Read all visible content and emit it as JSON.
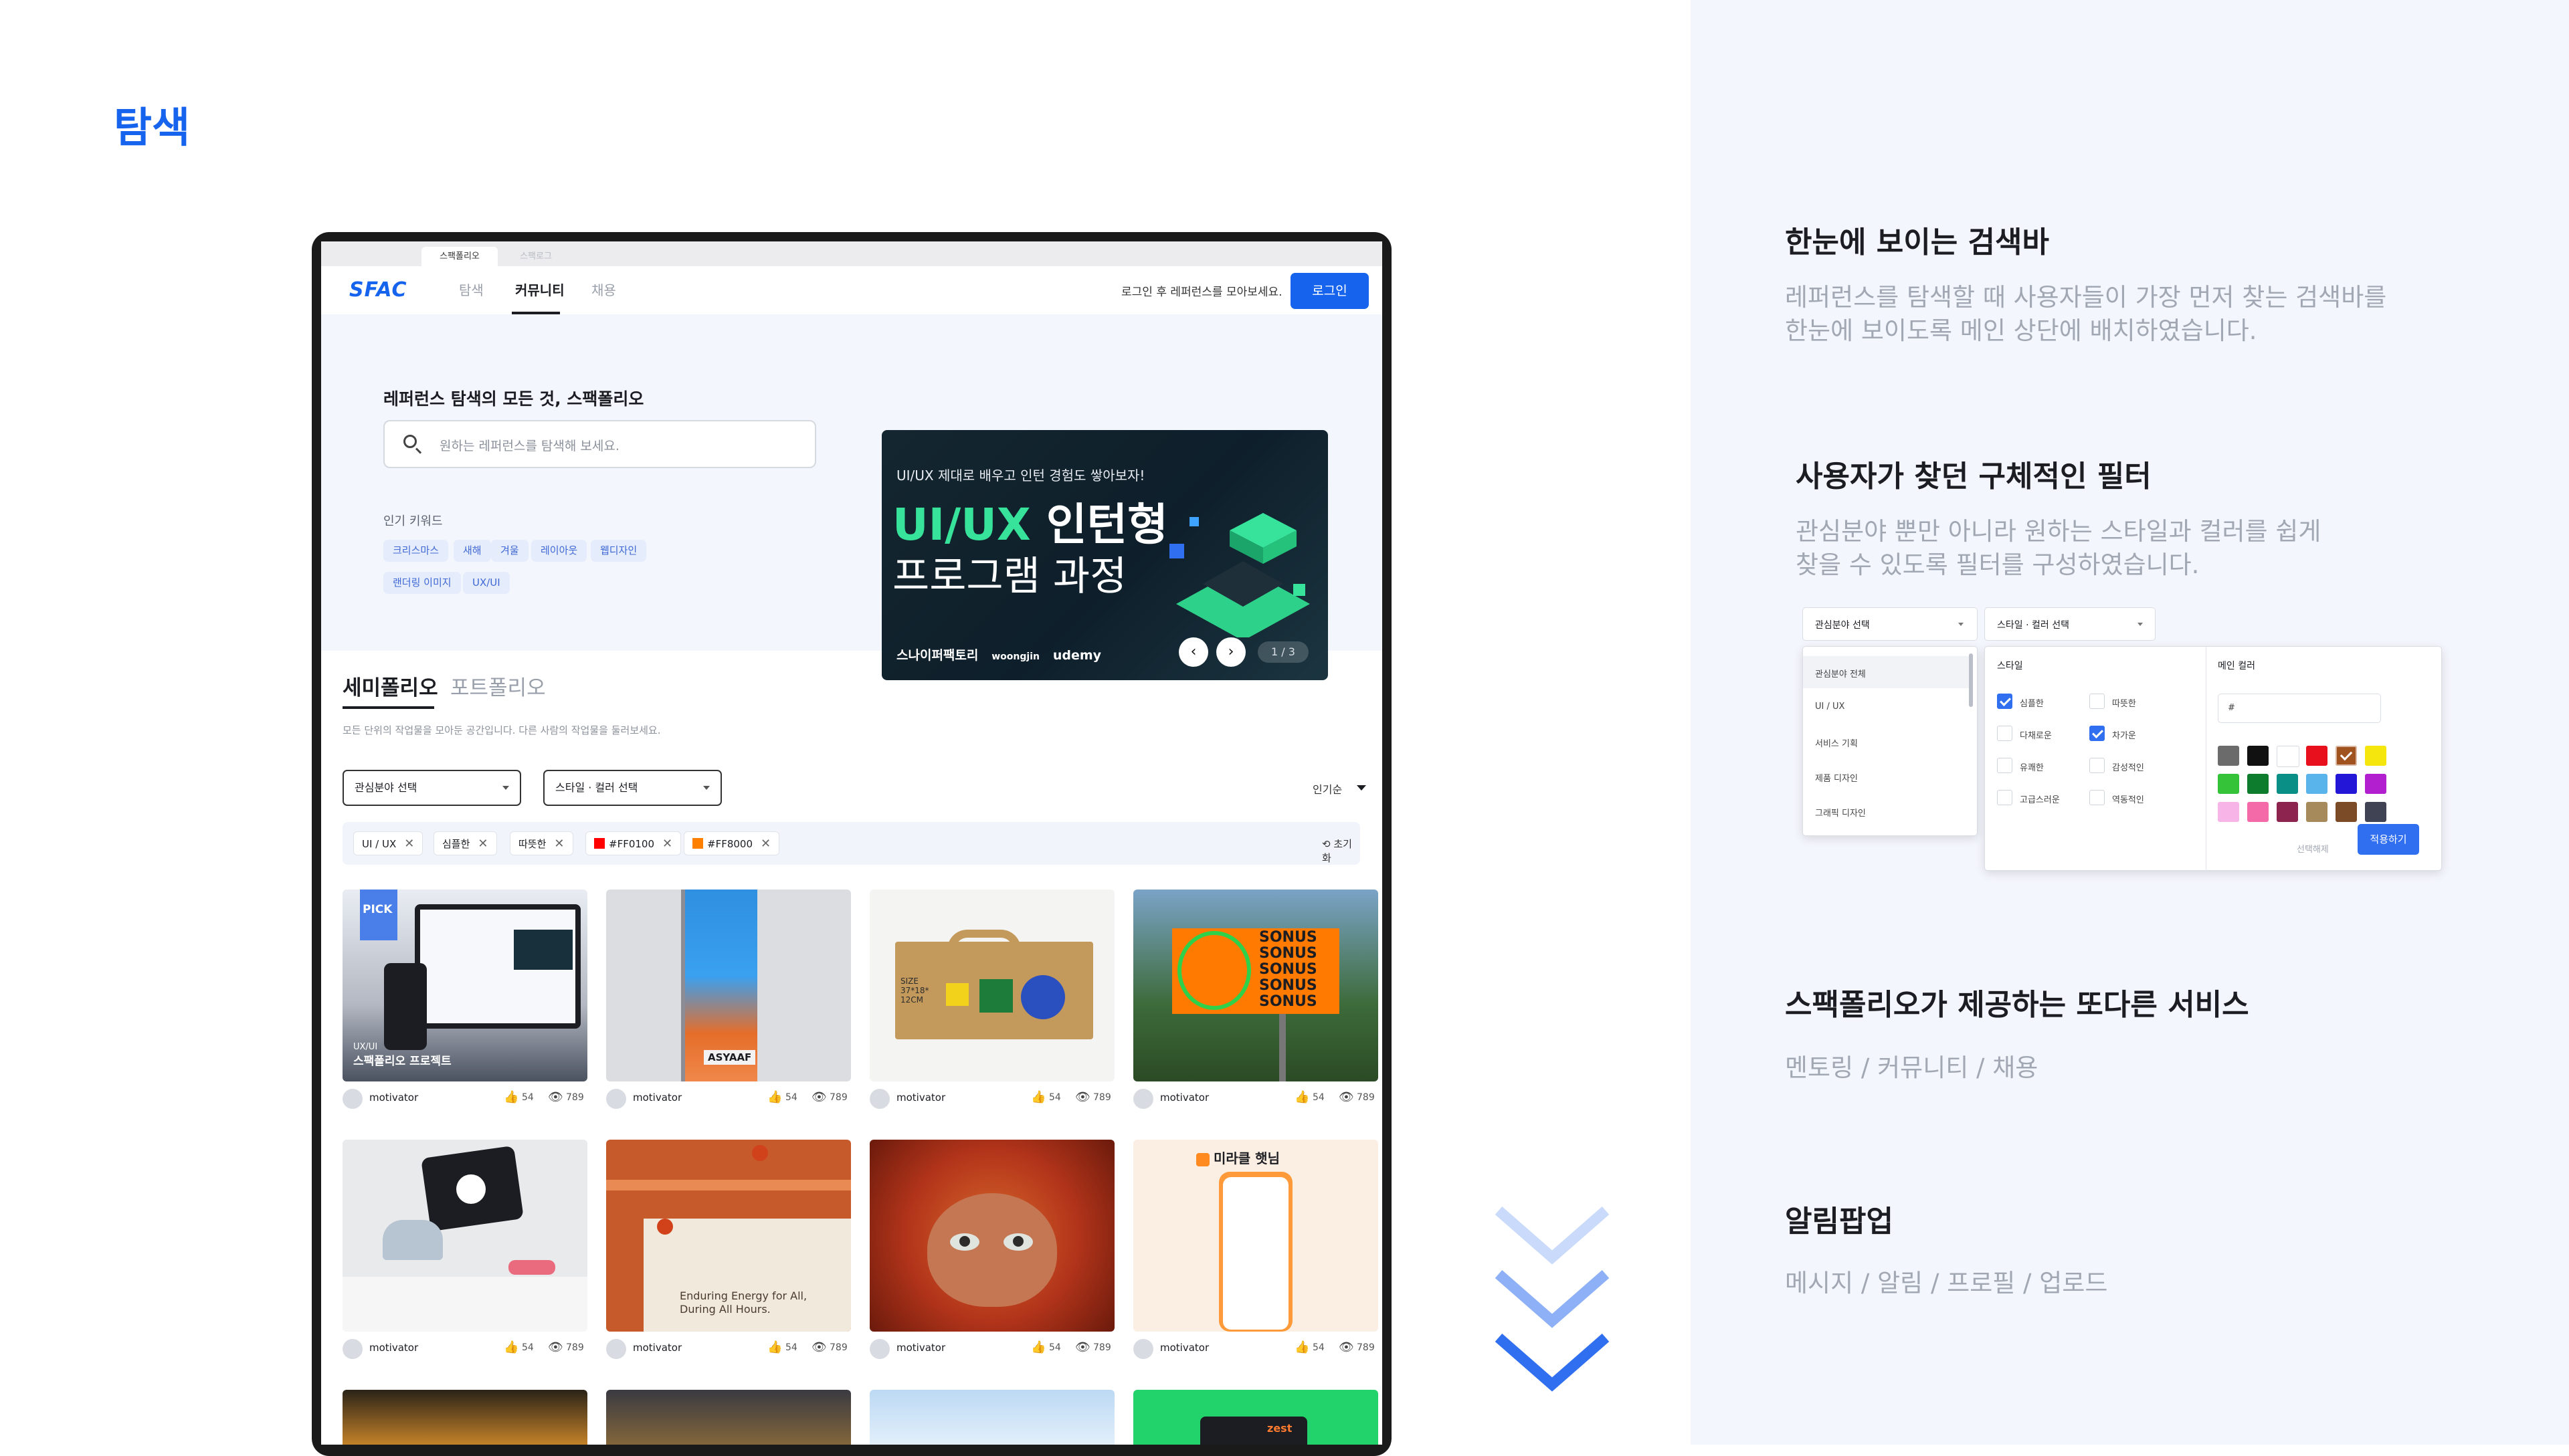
{
  "page_title": "탐색",
  "browser_tabs": [
    {
      "label": "스팩폴리오",
      "active": true
    },
    {
      "label": "스팩로그",
      "active": false
    }
  ],
  "nav": {
    "logo": "SFAC",
    "items": [
      {
        "label": "탐색",
        "active": false
      },
      {
        "label": "커뮤니티",
        "active": true
      },
      {
        "label": "채용",
        "active": false
      }
    ],
    "hint": "로그인 후 레퍼런스를 모아보세요.",
    "login_label": "로그인"
  },
  "hero": {
    "title": "레퍼런스 탐색의 모든 것, 스팩폴리오",
    "search_placeholder": "원하는 레퍼런스를 탐색해 보세요.",
    "popular_label": "인기 키워드",
    "keywords": [
      "크리스마스",
      "새해",
      "겨울",
      "레이아웃",
      "웹디자인",
      "랜더링 이미지",
      "UX/UI"
    ],
    "banner": {
      "subtitle": "UI/UX 제대로 배우고 인턴 경험도 쌓아보자!",
      "line1_accent": "UI/UX",
      "line1_rest": " 인턴형",
      "line2": "프로그램 과정",
      "partners": [
        "스나이퍼팩토리",
        "woongjin",
        "udemy"
      ],
      "counter": "1 / 3",
      "prev_glyph": "‹",
      "next_glyph": "›"
    }
  },
  "section": {
    "tabs": [
      {
        "label": "세미폴리오",
        "active": true
      },
      {
        "label": "포트폴리오",
        "active": false
      }
    ],
    "description": "모든 단위의 작업물을 모아둔 공간입니다. 다른 사람의 작업물을 둘러보세요.",
    "select_interest": "관심분야 선택",
    "select_style": "스타일 · 컬러 선택",
    "sort_label": "인기순",
    "active_filters": [
      {
        "label": "UI / UX"
      },
      {
        "label": "심플한"
      },
      {
        "label": "따뜻한"
      },
      {
        "label": "#FF0100",
        "color": "#ff0100"
      },
      {
        "label": "#FF8000",
        "color": "#ff8000"
      }
    ],
    "reset_label": "⟲ 초기화"
  },
  "cards": [
    {
      "author": "motivator",
      "likes": "54",
      "views": "789",
      "category": "UX/UI",
      "caption": "스팩폴리오 프로젝트",
      "badge": "PICK"
    },
    {
      "author": "motivator",
      "likes": "54",
      "views": "789",
      "caption": "ASYAAF"
    },
    {
      "author": "motivator",
      "likes": "54",
      "views": "789",
      "caption": "SIZE 37*18* 12CM"
    },
    {
      "author": "motivator",
      "likes": "54",
      "views": "789",
      "caption": "SONUS SONUS SONUS SONUS SONUS"
    },
    {
      "author": "motivator",
      "likes": "54",
      "views": "789"
    },
    {
      "author": "motivator",
      "likes": "54",
      "views": "789",
      "caption": "Enduring Energy for All, During All Hours."
    },
    {
      "author": "motivator",
      "likes": "54",
      "views": "789"
    },
    {
      "author": "motivator",
      "likes": "54",
      "views": "789",
      "caption": "미라클 햇님"
    }
  ],
  "bottom_row_label": "zest",
  "right_panel": {
    "features": [
      {
        "title": "한눈에 보이는 검색바",
        "desc_lines": [
          "레퍼런스를 탐색할 때 사용자들이 가장 먼저 찾는 검색바를",
          "한눈에 보이도록 메인 상단에 배치하였습니다."
        ]
      },
      {
        "title": "사용자가 찾던 구체적인 필터",
        "desc_lines": [
          "관심분야 뿐만 아니라 원하는 스타일과 컬러를 쉽게",
          "찾을 수 있도록 필터를 구성하였습니다."
        ]
      },
      {
        "title": "스팩폴리오가 제공하는 또다른 서비스",
        "desc_lines": [
          "멘토링 / 커뮤니티 / 채용"
        ]
      },
      {
        "title": "알림팝업",
        "desc_lines": [
          "메시지 / 알림 /  프로필 / 업로드"
        ]
      }
    ],
    "filter_mock": {
      "select_interest": "관심분야 선택",
      "select_style": "스타일 · 컬러 선택",
      "interest_options": [
        "관심분야 전체",
        "UI / UX",
        "서비스 기획",
        "제품 디자인",
        "그래픽 디자인"
      ],
      "style_label": "스타일",
      "styles": [
        {
          "label": "심플한",
          "checked": true
        },
        {
          "label": "따뜻한",
          "checked": false
        },
        {
          "label": "다채로운",
          "checked": false
        },
        {
          "label": "차가운",
          "checked": true
        },
        {
          "label": "유쾌한",
          "checked": false
        },
        {
          "label": "감성적인",
          "checked": false
        },
        {
          "label": "고급스러운",
          "checked": false
        },
        {
          "label": "역동적인",
          "checked": false
        }
      ],
      "color_label": "메인 컬러",
      "color_input": "#",
      "swatches": [
        "#6b6b6b",
        "#111111",
        "#ffffff",
        "#e8101c",
        "#a0521f",
        "#f5e60d",
        "#35c33a",
        "#0d7c2c",
        "#0a8f86",
        "#58b4ea",
        "#2316d6",
        "#b11fcf",
        "#f7b4e6",
        "#f46aa8",
        "#8d2450",
        "#a68a5b",
        "#7b4a26",
        "#3f4354"
      ],
      "selected_swatch": 4,
      "reset_label": "선택해제",
      "apply_label": "적용하기"
    }
  }
}
